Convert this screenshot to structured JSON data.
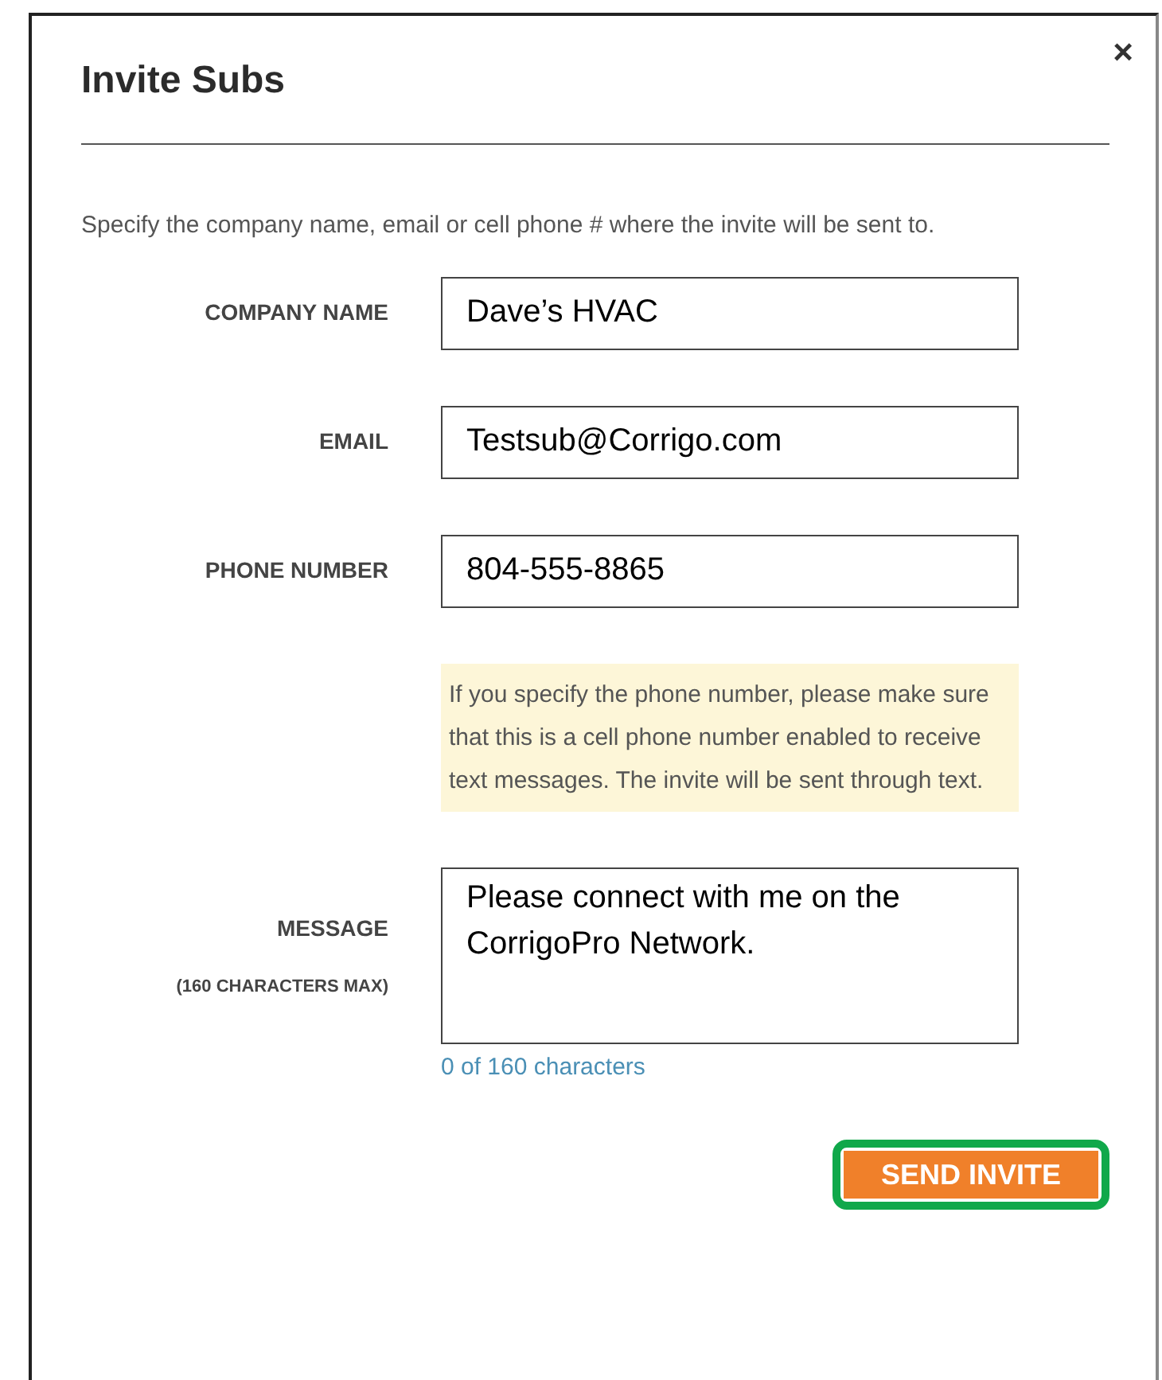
{
  "dialog": {
    "title": "Invite Subs",
    "close": "×",
    "intro": "Specify the company name, email or cell phone # where the invite will be sent to.",
    "fields": [
      {
        "label": "COMPANY NAME",
        "value": "Dave’s HVAC"
      },
      {
        "label": "EMAIL",
        "value": "Testsub@Corrigo.com"
      },
      {
        "label": "PHONE NUMBER",
        "value": "804-555-8865"
      }
    ],
    "note": "If you specify the phone number, please make sure that this is a cell phone number enabled to receive text messages. The invite will be sent through text.",
    "message": {
      "label": "MESSAGE",
      "sublabel": "(160 CHARACTERS MAX)",
      "value": "Please connect with me on the CorrigoPro Network.",
      "counter": "0 of 160 characters"
    },
    "button": {
      "label": "SEND INVITE",
      "highlighted": true
    }
  }
}
